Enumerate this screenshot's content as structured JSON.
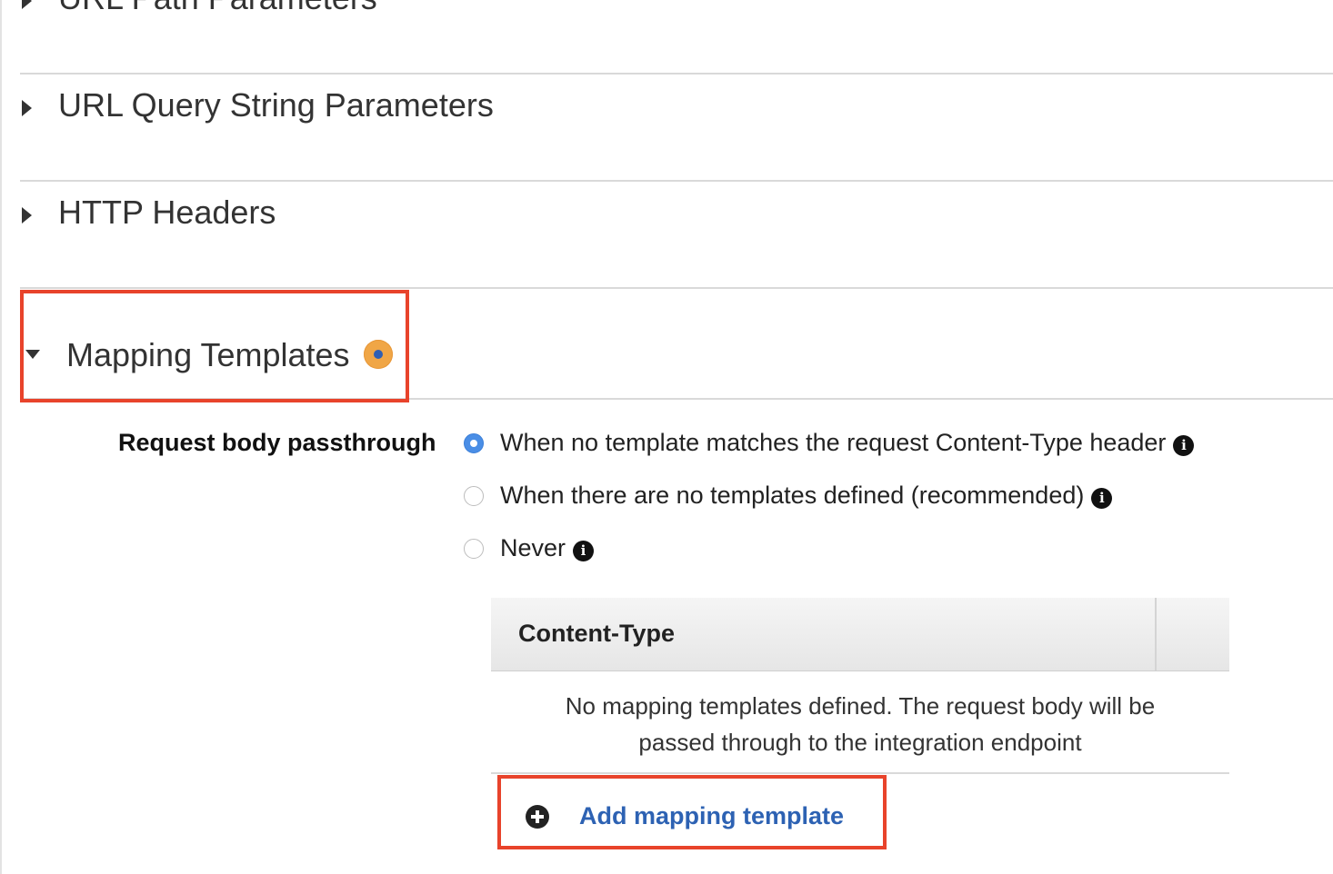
{
  "sections": [
    {
      "label": "URL Path Parameters",
      "expanded": false
    },
    {
      "label": "URL Query String Parameters",
      "expanded": false
    },
    {
      "label": "HTTP Headers",
      "expanded": false
    },
    {
      "label": "Mapping Templates",
      "expanded": true
    }
  ],
  "mapping": {
    "passthrough_label": "Request body passthrough",
    "options": [
      {
        "label": "When no template matches the request Content-Type header",
        "selected": true
      },
      {
        "label": "When there are no templates defined (recommended)",
        "selected": false
      },
      {
        "label": "Never",
        "selected": false
      }
    ],
    "table": {
      "column_header": "Content-Type",
      "empty_line1": "No mapping templates defined. The request body will be",
      "empty_line2": "passed through to the integration endpoint"
    },
    "add_label": "Add mapping template"
  },
  "info_glyph": "i",
  "colors": {
    "highlight": "#e8432b",
    "link": "#2d62b3",
    "radio_selected": "#4a8ee6",
    "status_dot": "#f0a646"
  }
}
